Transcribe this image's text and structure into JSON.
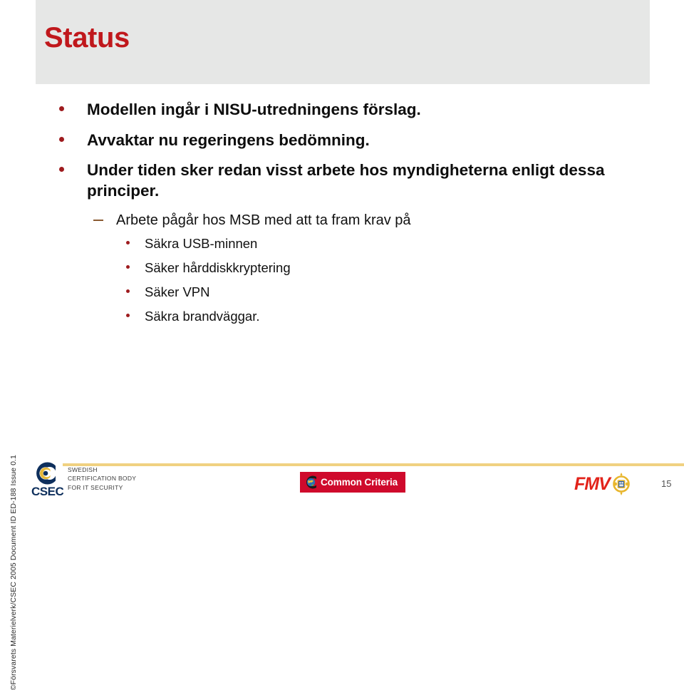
{
  "slide": {
    "title": "Status",
    "page_number": "15",
    "title_color": "#c0181c",
    "title_band_color": "#e6e7e6",
    "bullet_color": "#9e1b1e"
  },
  "bullets": [
    {
      "level": 1,
      "text": "Modellen ingår i NISU-utredningens förslag."
    },
    {
      "level": 1,
      "text": "Avvaktar nu regeringens bedömning."
    },
    {
      "level": 1,
      "text": "Under tiden sker redan visst arbete hos myndigheterna enligt dessa principer."
    },
    {
      "level": 2,
      "text": "Arbete pågår hos MSB med att ta fram krav på"
    },
    {
      "level": 3,
      "text": "Säkra USB-minnen"
    },
    {
      "level": 3,
      "text": "Säker hårddiskkryptering"
    },
    {
      "level": 3,
      "text": "Säker VPN"
    },
    {
      "level": 3,
      "text": "Säkra brandväggar."
    }
  ],
  "side_credit": "©Försvarets Materielverk/CSEC 2005 Document ID ED-188  Issue 0.1",
  "footer": {
    "csec": {
      "wordmark": "CSEC",
      "tagline_line1": "SWEDISH",
      "tagline_line2": "CERTIFICATION BODY",
      "tagline_line3": "FOR IT SECURITY",
      "navy": "#0e2f5c",
      "gold": "#e8b93a"
    },
    "common_criteria": {
      "label": "Common Criteria",
      "background": "#cf0a2c"
    },
    "fmv": {
      "wordmark": "FMV",
      "color": "#e2231a",
      "crest_gold": "#e8b62c"
    },
    "rule_color": "#f0d181"
  }
}
